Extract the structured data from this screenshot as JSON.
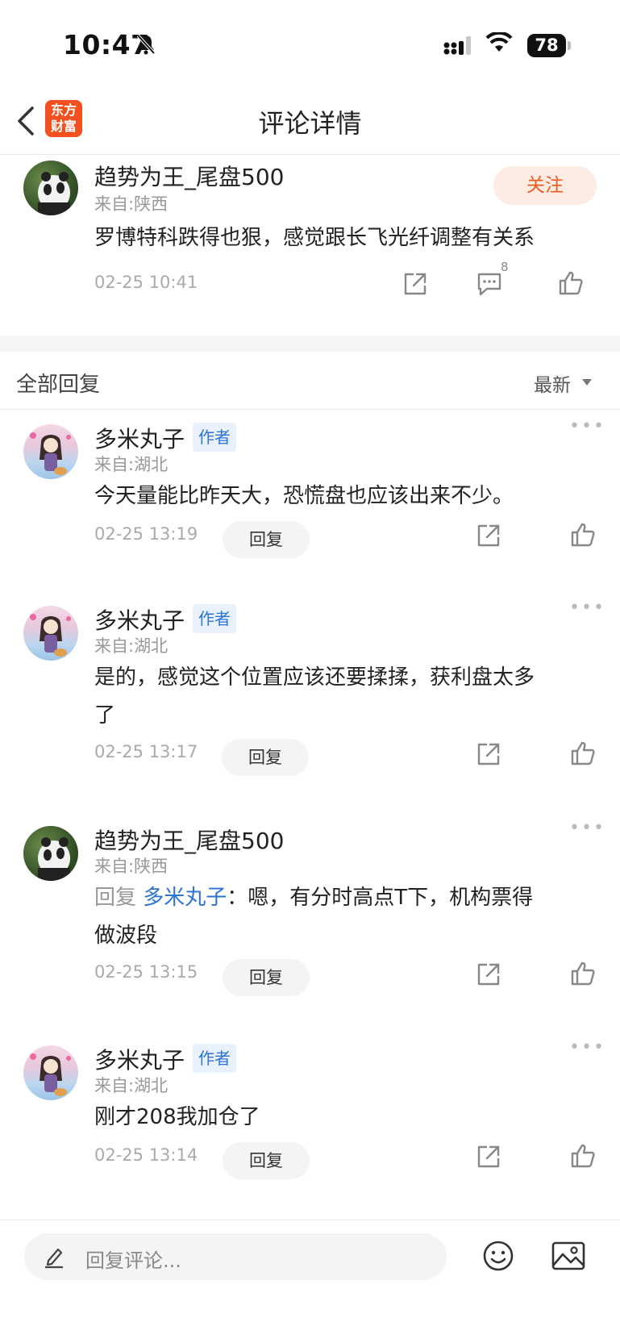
{
  "status_bar": {
    "time": "10:47",
    "battery": "78"
  },
  "nav": {
    "logo_line1": "东方",
    "logo_line2": "财富",
    "title": "评论详情"
  },
  "main_comment": {
    "username": "趋势为王_尾盘500",
    "location": "来自:陕西",
    "follow_label": "关注",
    "text": "罗博特科跌得也狠，感觉跟长飞光纤调整有关系",
    "time": "02-25 10:41",
    "comment_count": "8"
  },
  "replies_header": {
    "title": "全部回复",
    "sort_label": "最新"
  },
  "replies": [
    {
      "username": "多米丸子",
      "author_tag": "作者",
      "location": "来自:湖北",
      "text": "今天量能比昨天大，恐慌盘也应该出来不少。",
      "time": "02-25 13:19",
      "reply_label": "回复"
    },
    {
      "username": "多米丸子",
      "author_tag": "作者",
      "location": "来自:湖北",
      "text_line1": "是的，感觉这个位置应该还要揉揉，获利盘太多",
      "text_line2": "了",
      "time": "02-25 13:17",
      "reply_label": "回复"
    },
    {
      "username": "趋势为王_尾盘500",
      "location": "来自:陕西",
      "reply_prefix": "回复",
      "reply_target": "多米丸子",
      "text_line1": "：嗯，有分时高点T下，机构票得",
      "text_line2": "做波段",
      "time": "02-25 13:15",
      "reply_label": "回复"
    },
    {
      "username": "多米丸子",
      "author_tag": "作者",
      "location": "来自:湖北",
      "text": "刚才208我加仓了",
      "time": "02-25 13:14",
      "reply_label": "回复"
    }
  ],
  "bottom_bar": {
    "input_placeholder": "回复评论..."
  },
  "icons": [
    "bell-slash-icon",
    "signal-icon",
    "wifi-icon",
    "back-icon",
    "share-icon",
    "comment-icon",
    "like-icon",
    "more-icon",
    "pencil-icon",
    "emoji-icon",
    "image-icon"
  ],
  "colors": {
    "accent_orange": "#f05a22",
    "follow_bg": "#fdece3",
    "link_blue": "#2b74d6",
    "tag_bg": "#e8f1fc"
  }
}
